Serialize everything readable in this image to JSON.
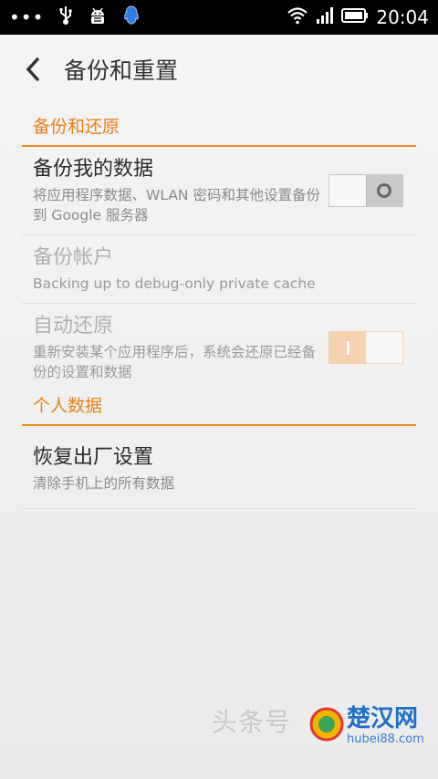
{
  "status_bar": {
    "dots": "•••",
    "time": "20:04",
    "icons": [
      "usb-icon",
      "android-debug-icon",
      "qq-icon",
      "wifi-icon",
      "signal-icon",
      "battery-icon"
    ]
  },
  "header": {
    "title": "备份和重置"
  },
  "sections": [
    {
      "header": "备份和还原",
      "items": [
        {
          "title": "备份我的数据",
          "summary": "将应用程序数据、WLAN 密码和其他设置备份到 Google 服务器",
          "switch": "off",
          "enabled": true
        },
        {
          "title": "备份帐户",
          "summary": "Backing up to debug-only private cache",
          "enabled": false
        },
        {
          "title": "自动还原",
          "summary": "重新安装某个应用程序后，系统会还原已经备份的设置和数据",
          "switch": "on",
          "enabled": false
        }
      ]
    },
    {
      "header": "个人数据",
      "items": [
        {
          "title": "恢复出厂设置",
          "summary": "清除手机上的所有数据",
          "enabled": true
        }
      ]
    }
  ],
  "watermark": {
    "text": "头条号",
    "logo_text": "楚汉网",
    "logo_sub": "hubei88.com"
  },
  "colors": {
    "accent": "#e8801a",
    "divider": "#ee8a1f",
    "background": "#f2f2f2"
  }
}
